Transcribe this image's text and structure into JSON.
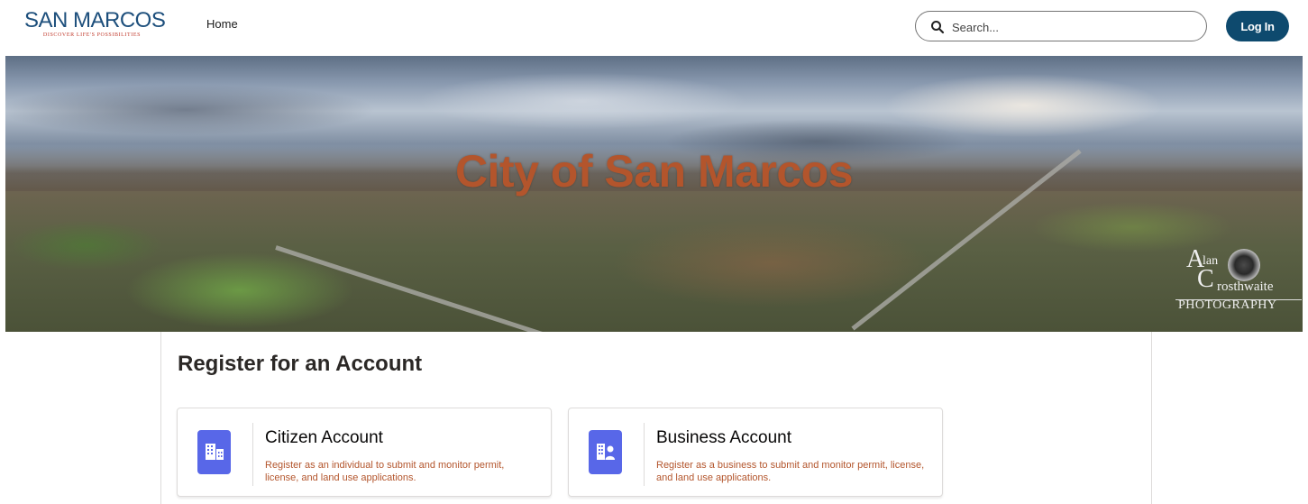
{
  "header": {
    "logo_text": "SAN MARCOS",
    "logo_tagline": "DISCOVER LIFE'S POSSIBILITIES",
    "nav_home": "Home",
    "search_placeholder": "Search...",
    "login_label": "Log In"
  },
  "hero": {
    "title": "City of San Marcos",
    "watermark": {
      "a": "A",
      "lan": "lan",
      "c": "C",
      "rosthwaite": "rosthwaite",
      "photography": "PHOTOGRAPHY"
    }
  },
  "main": {
    "heading": "Register for an Account",
    "cards": [
      {
        "title": "Citizen Account",
        "description": "Register as an individual to submit and monitor permit, license, and land use applications.",
        "icon": "building-icon"
      },
      {
        "title": "Business Account",
        "description": "Register as a business to submit and monitor permit, license, and land use applications.",
        "icon": "business-person-icon"
      }
    ]
  },
  "colors": {
    "brand_blue": "#1d4f7c",
    "login_bg": "#0e4a6e",
    "accent_orange": "#b3552c",
    "icon_bg": "#5867e8"
  }
}
